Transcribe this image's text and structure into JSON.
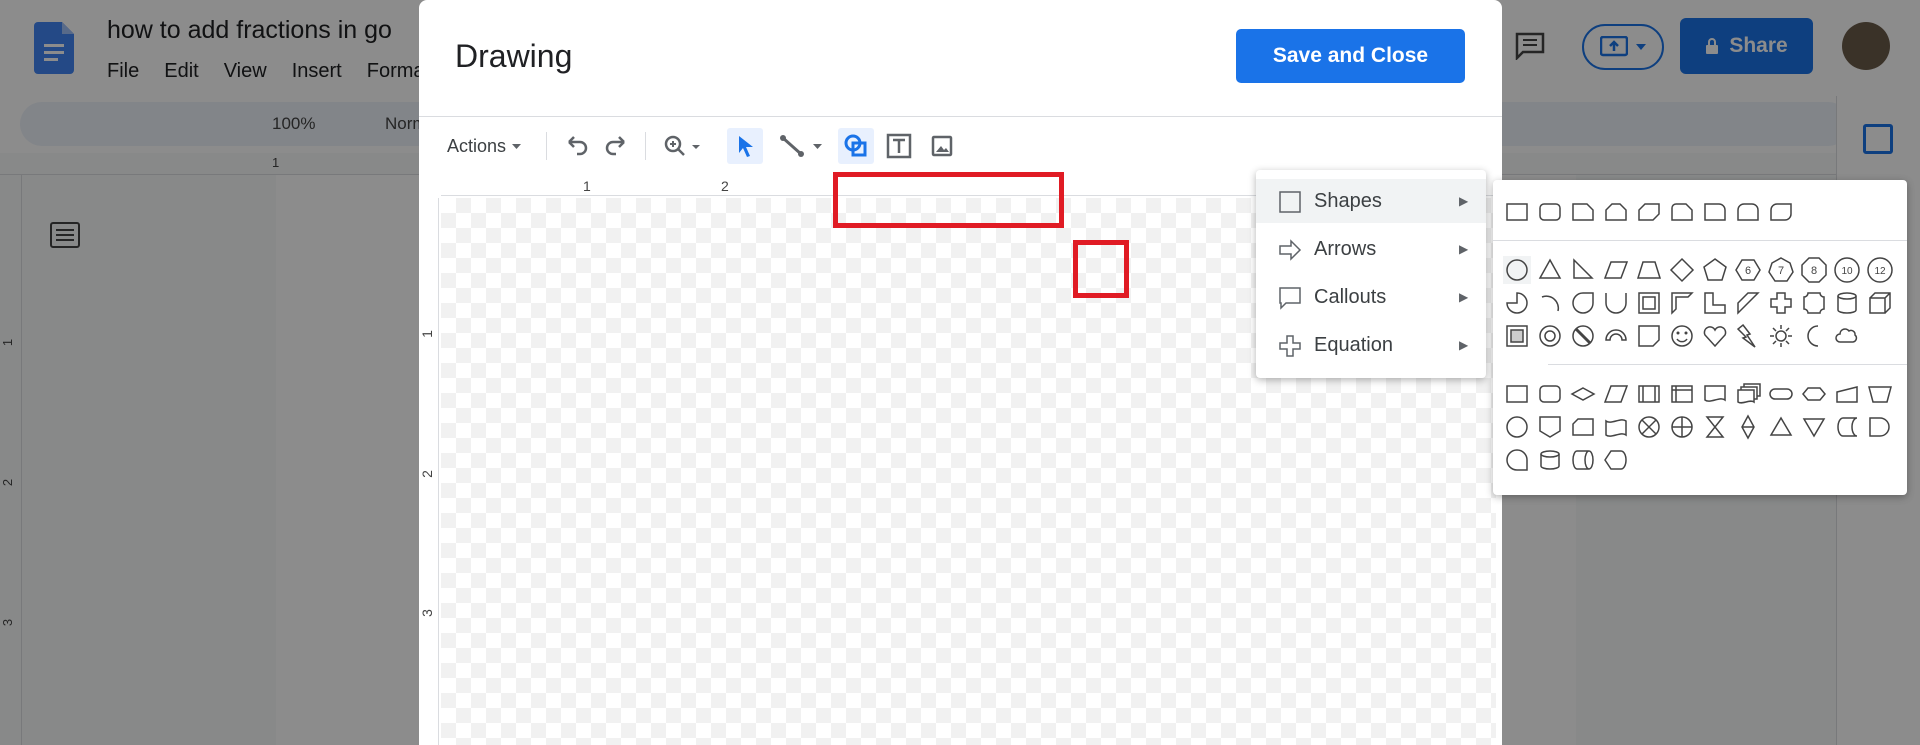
{
  "doc": {
    "title": "how to add fractions in go",
    "menu": [
      "File",
      "Edit",
      "View",
      "Insert",
      "Forma"
    ],
    "zoom": "100%",
    "style": "Norm",
    "share_label": "Share",
    "left_ruler_labels": [
      "1",
      "2",
      "3"
    ],
    "top_ruler_label": "1"
  },
  "dialog": {
    "title": "Drawing",
    "save_label": "Save and Close",
    "actions_label": "Actions",
    "ruler_h": [
      "1",
      "2"
    ],
    "ruler_v": [
      "1",
      "2",
      "3"
    ]
  },
  "insert_menu": {
    "items": [
      {
        "label": "Shapes",
        "icon": "square-outline-icon"
      },
      {
        "label": "Arrows",
        "icon": "arrow-outline-icon"
      },
      {
        "label": "Callouts",
        "icon": "speech-bubble-icon"
      },
      {
        "label": "Equation",
        "icon": "plus-outline-icon"
      }
    ]
  },
  "shapes_panel": {
    "number_shapes": [
      "6",
      "7",
      "8",
      "10",
      "12"
    ]
  },
  "colors": {
    "accent": "#1a73e8",
    "highlight": "#e01b24"
  }
}
